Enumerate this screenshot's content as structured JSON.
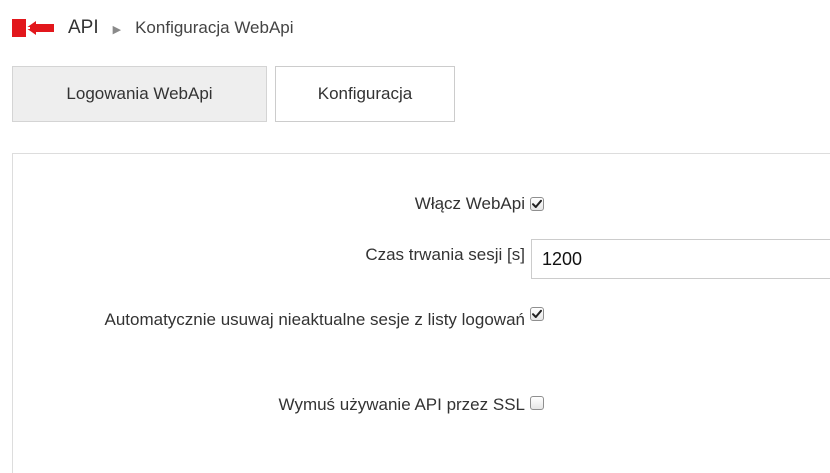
{
  "breadcrumb": {
    "root": "API",
    "current": "Konfiguracja WebApi"
  },
  "tabs": [
    {
      "label": "Logowania WebApi",
      "active": false
    },
    {
      "label": "Konfiguracja",
      "active": true
    }
  ],
  "form": {
    "enable_webapi": {
      "label": "Włącz WebApi",
      "checked": true
    },
    "session_duration": {
      "label": "Czas trwania sesji [s]",
      "value": "1200"
    },
    "auto_remove_sessions": {
      "label": "Automatycznie usuwaj nieaktualne sesje z listy logowań",
      "checked": true
    },
    "force_ssl": {
      "label": "Wymuś używanie API przez SSL",
      "checked": false
    }
  },
  "colors": {
    "brand_red": "#e2171c",
    "tab_inactive_bg": "#eeeeee",
    "border": "#dddddd"
  },
  "icons": {
    "logo": "brand-logo-icon",
    "separator": "triangle-right-icon",
    "checkmark": "check-icon"
  }
}
